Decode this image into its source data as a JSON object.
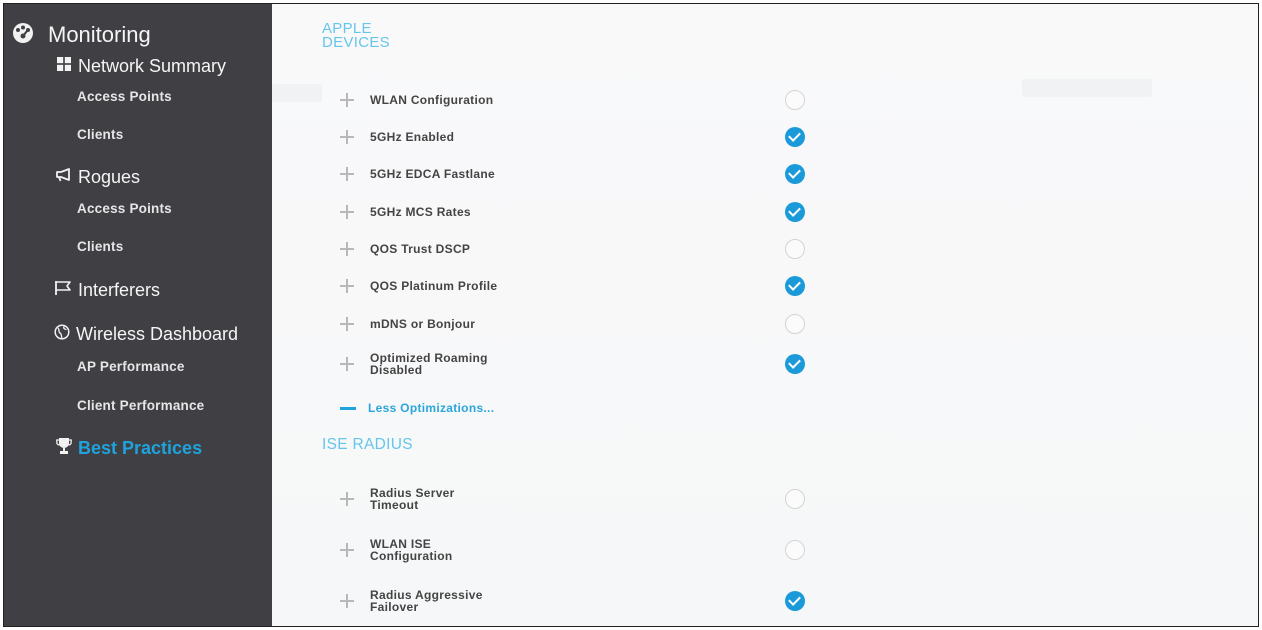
{
  "sidebar": {
    "top": {
      "label": "Monitoring",
      "icon": "dashboard-icon"
    },
    "network_summary": {
      "label": "Network Summary",
      "icon": "grid-icon",
      "items": [
        "Access Points",
        "Clients"
      ]
    },
    "rogues": {
      "label": "Rogues",
      "icon": "megaphone-icon",
      "items": [
        "Access Points",
        "Clients"
      ]
    },
    "interferers": {
      "label": "Interferers",
      "icon": "flag-icon"
    },
    "wireless_dashboard": {
      "label": "Wireless Dashboard",
      "icon": "globe-icon",
      "items": [
        "AP Performance",
        "Client Performance"
      ]
    },
    "best_practices": {
      "label": "Best Practices",
      "icon": "trophy-icon"
    }
  },
  "main": {
    "apple_title": "APPLE\nDEVICES",
    "apple_rows": [
      {
        "label": "WLAN Configuration",
        "enabled": false
      },
      {
        "label": "5GHz Enabled",
        "enabled": true
      },
      {
        "label": "5GHz EDCA Fastlane",
        "enabled": true
      },
      {
        "label": "5GHz MCS Rates",
        "enabled": true
      },
      {
        "label": "QOS Trust DSCP",
        "enabled": false
      },
      {
        "label": "QOS Platinum Profile",
        "enabled": true
      },
      {
        "label": "mDNS or Bonjour",
        "enabled": false
      },
      {
        "label": "Optimized Roaming\nDisabled",
        "enabled": true
      }
    ],
    "less_label": "Less Optimizations...",
    "ise_title": "ISE RADIUS",
    "ise_rows": [
      {
        "label": "Radius Server\nTimeout",
        "enabled": false
      },
      {
        "label": "WLAN ISE\nConfiguration",
        "enabled": false
      },
      {
        "label": "Radius Aggressive\nFailover",
        "enabled": true
      }
    ]
  },
  "colors": {
    "accent": "#1ea3dc",
    "sidebar_bg": "#3f3f44",
    "check": "#1a9ad9"
  }
}
